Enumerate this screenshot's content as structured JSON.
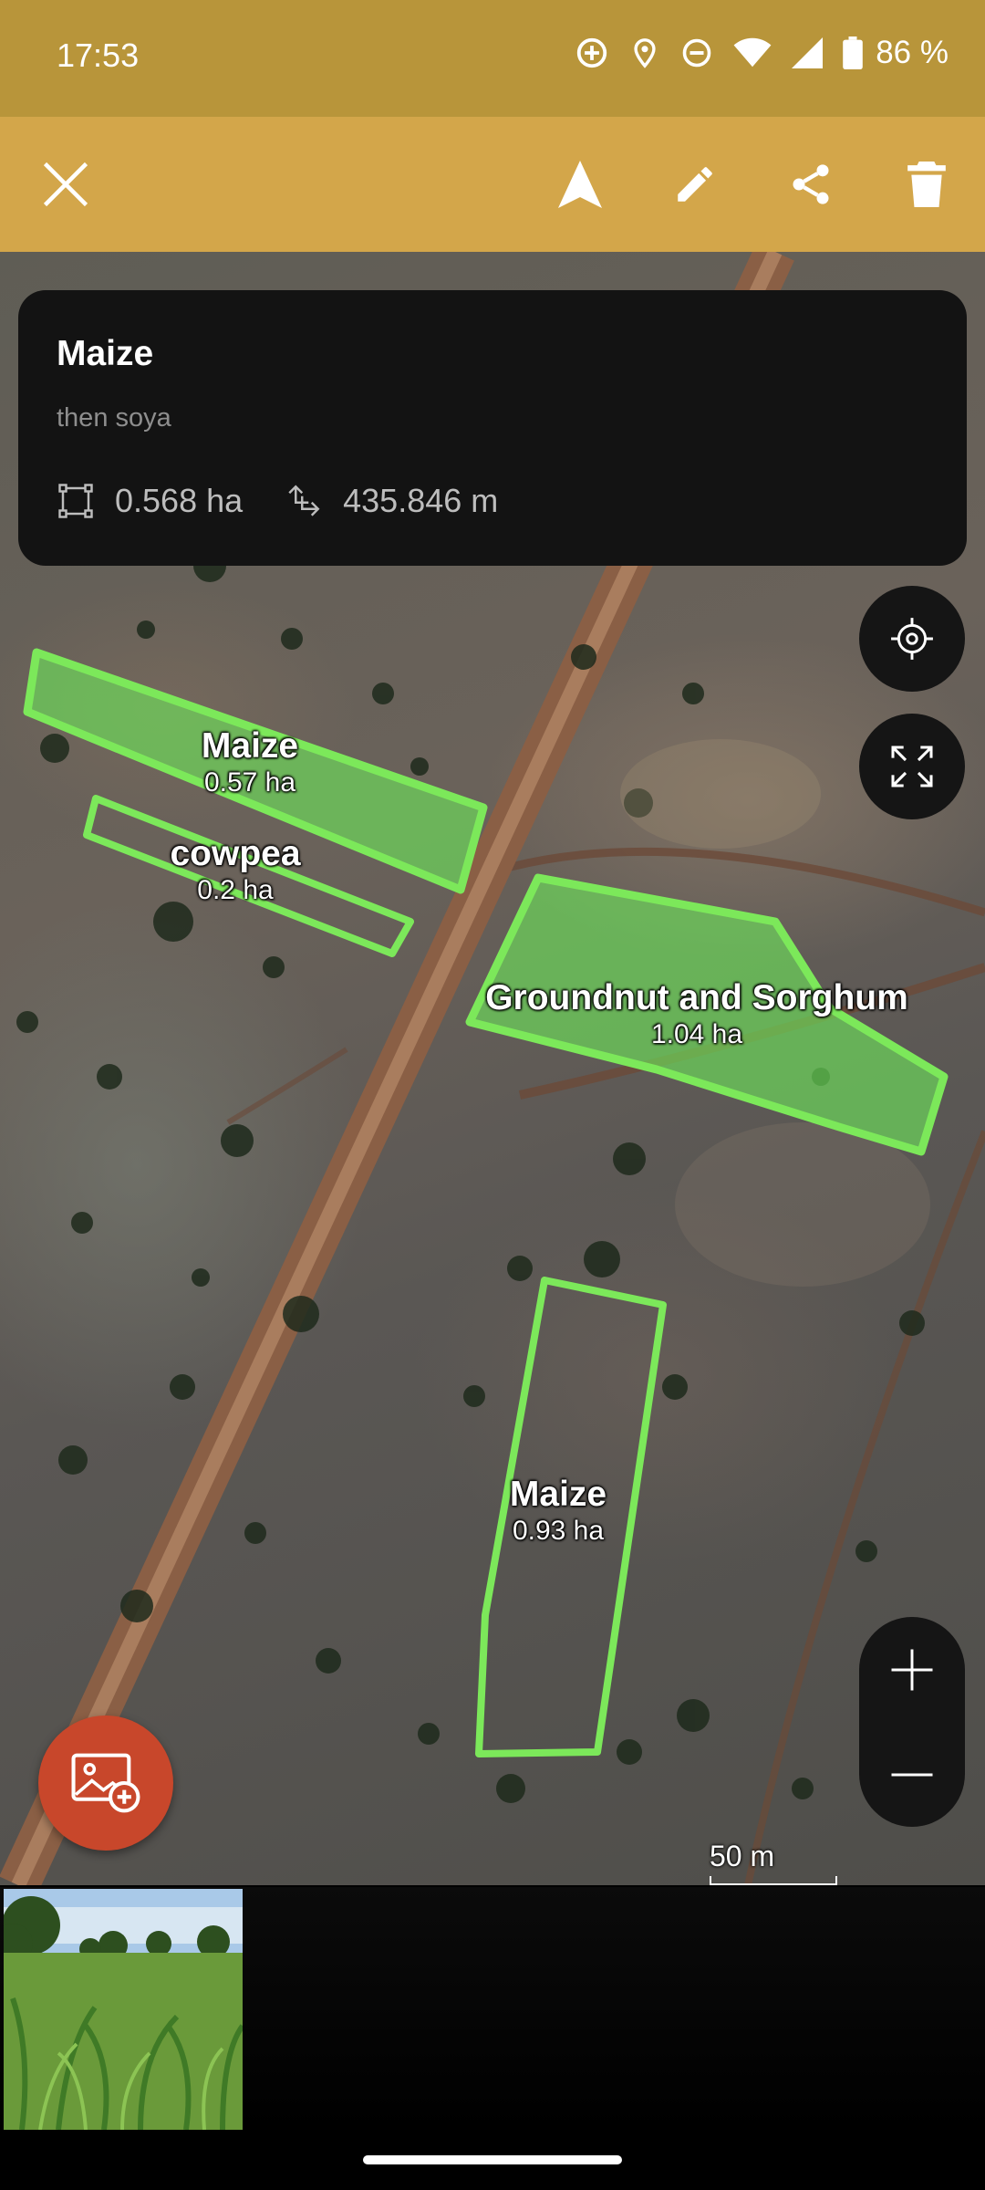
{
  "status_bar": {
    "time": "17:53",
    "battery": "86 %"
  },
  "toolbar": {
    "close_icon": "close-icon",
    "navigate_icon": "navigation-arrow-icon",
    "edit_icon": "pencil-icon",
    "share_icon": "share-icon",
    "delete_icon": "trash-icon"
  },
  "info_card": {
    "title": "Maize",
    "subtitle": "then soya",
    "area": "0.568 ha",
    "perimeter": "435.846 m"
  },
  "map": {
    "fields": [
      {
        "name": "Maize",
        "area": "0.57 ha"
      },
      {
        "name": "cowpea",
        "area": "0.2 ha"
      },
      {
        "name": "Groundnut and Sorghum",
        "area": "1.04 ha"
      },
      {
        "name": "Maize",
        "area": "0.93 ha"
      }
    ],
    "scale_label": "50 m"
  },
  "colors": {
    "status_bar": "#B8953A",
    "toolbar": "#D3A64A",
    "field_outline": "#7CE85A",
    "fab": "#C8472B"
  }
}
